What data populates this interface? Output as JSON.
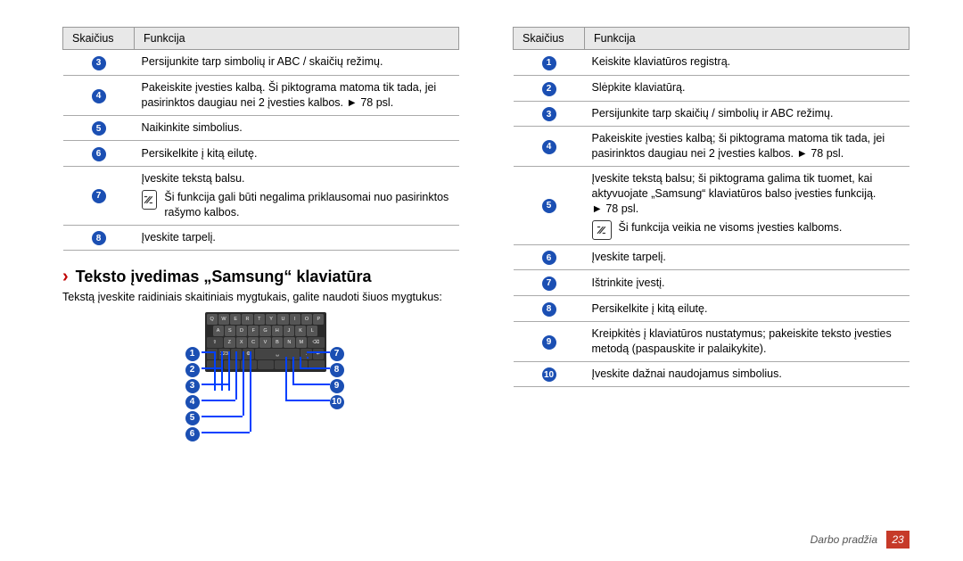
{
  "headers": {
    "num": "Skaičius",
    "func": "Funkcija"
  },
  "left_table": [
    {
      "n": 3,
      "text": "Persijunkite tarp simbolių ir ABC / skaičių režimų."
    },
    {
      "n": 4,
      "text": "Pakeiskite įvesties kalbą. Ši piktograma matoma tik tada, jei pasirinktos daugiau nei 2 įvesties kalbos. ► 78 psl."
    },
    {
      "n": 5,
      "text": "Naikinkite simbolius."
    },
    {
      "n": 6,
      "text": "Persikelkite į kitą eilutę."
    },
    {
      "n": 7,
      "text": "Įveskite tekstą balsu.",
      "note": "Ši funkcija gali būti negalima priklausomai nuo pasirinktos rašymo kalbos."
    },
    {
      "n": 8,
      "text": "Įveskite tarpelį."
    }
  ],
  "section": {
    "chevron": "›",
    "title": "Teksto įvedimas „Samsung“ klaviatūra",
    "text": "Tekstą įveskite raidiniais skaitiniais mygtukais, galite naudoti šiuos mygtukus:"
  },
  "kb_rows": [
    [
      "Q",
      "W",
      "E",
      "R",
      "T",
      "Y",
      "U",
      "I",
      "O",
      "P"
    ],
    [
      "A",
      "S",
      "D",
      "F",
      "G",
      "H",
      "J",
      "K",
      "L"
    ],
    [
      "Z",
      "X",
      "C",
      "V",
      "B",
      "N",
      "M"
    ]
  ],
  "left_callouts_left": [
    1,
    2,
    3,
    4,
    5,
    6
  ],
  "left_callouts_right": [
    7,
    8,
    9,
    10
  ],
  "right_table": [
    {
      "n": 1,
      "text": "Keiskite klaviatūros registrą."
    },
    {
      "n": 2,
      "text": "Slėpkite klaviatūrą."
    },
    {
      "n": 3,
      "text": "Persijunkite tarp skaičių / simbolių ir ABC režimų."
    },
    {
      "n": 4,
      "text": "Pakeiskite įvesties kalbą; ši piktograma matoma tik tada, jei pasirinktos daugiau nei 2 įvesties kalbos. ► 78 psl."
    },
    {
      "n": 5,
      "text": "Įveskite tekstą balsu; ši piktograma galima tik tuomet, kai aktyvuojate „Samsung“ klaviatūros balso įvesties funkciją.\n► 78 psl.",
      "note": "Ši funkcija veikia ne visoms įvesties kalboms."
    },
    {
      "n": 6,
      "text": "Įveskite tarpelį."
    },
    {
      "n": 7,
      "text": "Ištrinkite įvestį."
    },
    {
      "n": 8,
      "text": "Persikelkite į kitą eilutę."
    },
    {
      "n": 9,
      "text": "Kreipkitės į klaviatūros nustatymus; pakeiskite teksto įvesties metodą (paspauskite ir palaikykite)."
    },
    {
      "n": 10,
      "text": "Įveskite dažnai naudojamus simbolius."
    }
  ],
  "footer": {
    "label": "Darbo pradžia",
    "page": "23"
  }
}
